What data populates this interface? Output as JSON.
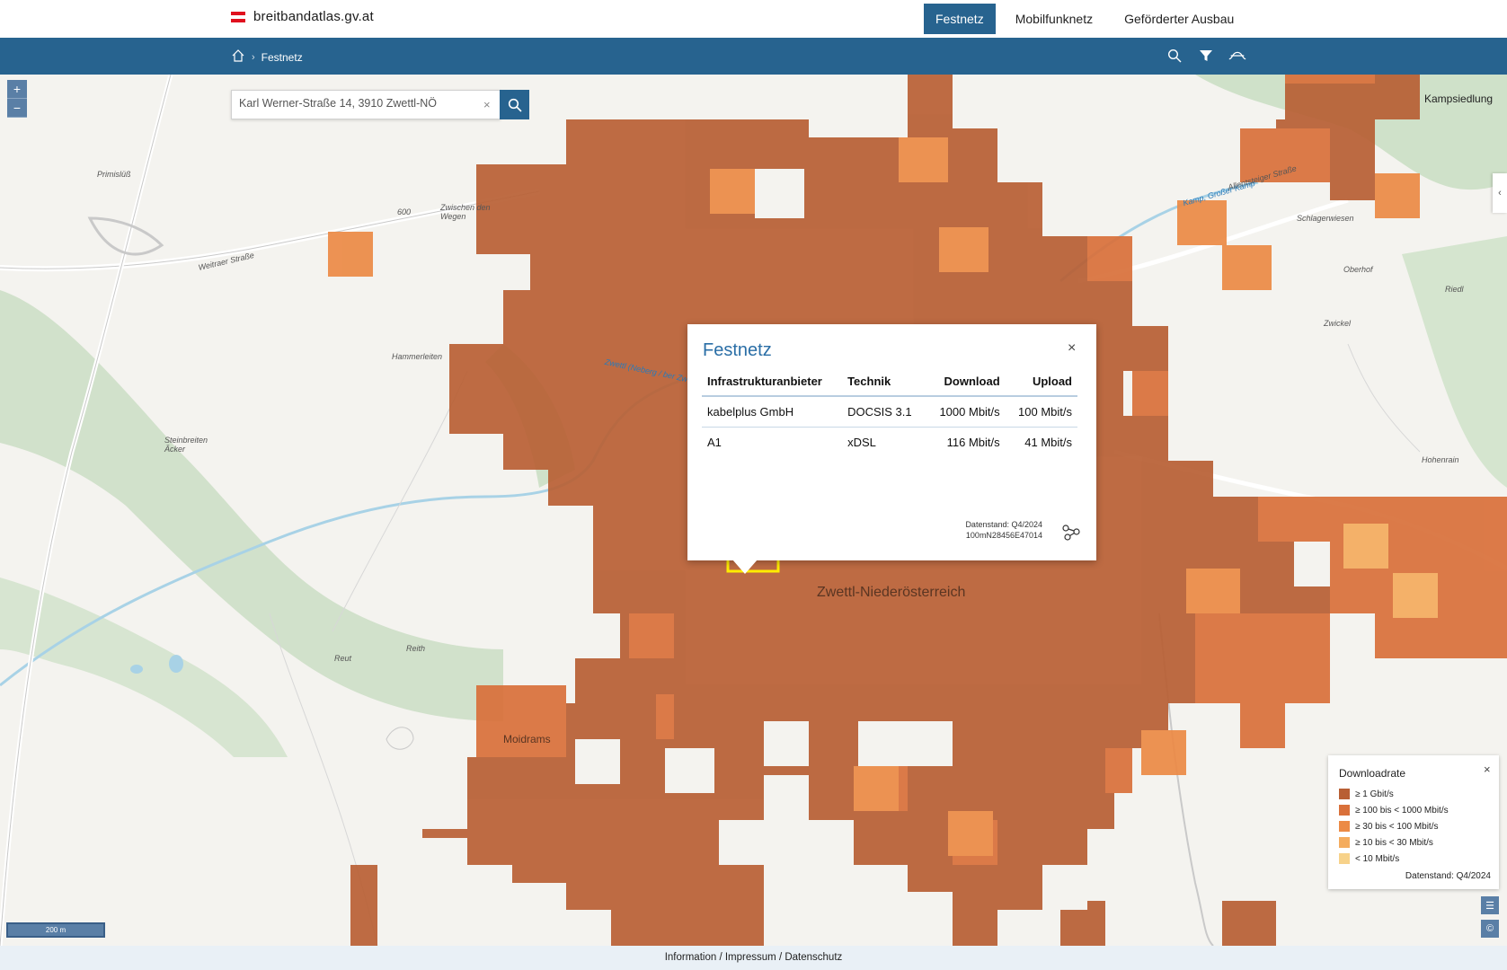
{
  "header": {
    "logo_text": "breitbandatlas.gv.at",
    "nav": [
      {
        "label": "Festnetz",
        "active": true
      },
      {
        "label": "Mobilfunknetz",
        "active": false
      },
      {
        "label": "Geförderter Ausbau",
        "active": false
      }
    ]
  },
  "breadcrumb": {
    "current": "Festnetz"
  },
  "search": {
    "value": "Karl Werner-Straße 14, 3910 Zwettl-NÖ",
    "clear": "×"
  },
  "zoom": {
    "in": "+",
    "out": "−"
  },
  "popup": {
    "title": "Festnetz",
    "close": "×",
    "columns": [
      "Infrastrukturanbieter",
      "Technik",
      "Download",
      "Upload"
    ],
    "rows": [
      [
        "kabelplus GmbH",
        "DOCSIS 3.1",
        "1000 Mbit/s",
        "100 Mbit/s"
      ],
      [
        "A1",
        "xDSL",
        "116 Mbit/s",
        "41 Mbit/s"
      ]
    ],
    "datenstand": "Datenstand: Q4/2024",
    "cell_id": "100mN28456E47014"
  },
  "legend": {
    "title": "Downloadrate",
    "close": "×",
    "items": [
      {
        "label": "≥ 1 Gbit/s",
        "color": "#b85f34"
      },
      {
        "label": "≥ 100 bis < 1000 Mbit/s",
        "color": "#d9703a"
      },
      {
        "label": "≥ 30 bis < 100 Mbit/s",
        "color": "#ec8a45"
      },
      {
        "label": "≥ 10 bis < 30 Mbit/s",
        "color": "#f4ac5e"
      },
      {
        "label": "< 10 Mbit/s",
        "color": "#f7d28a"
      }
    ],
    "datenstand": "Datenstand: Q4/2024"
  },
  "map_labels": {
    "town": "Zwettl-Niederösterreich",
    "kampsiedlung": "Kampsiedlung",
    "primislss": "Primislüß",
    "zwischen": "Zwischen den Wegen",
    "hammerleiten": "Hammerleiten",
    "steinbreiten": "Steinbreiten Äcker",
    "reut": "Reut",
    "reith": "Reith",
    "moidrams": "Moidrams",
    "oberhof": "Oberhof",
    "riedl": "Riedl",
    "zwickel": "Zwickel",
    "hohenrain": "Hohenrain",
    "schlagerwiesen": "Schlagerwiesen",
    "weitraer": "Weitraer Straße",
    "kamp": "Kamp, Großer Kamp",
    "allentsteiger": "Allentsteiger Straße",
    "zwettl_fluss": "Zwettl (Neberg / ber Zwe",
    "h600": "600"
  },
  "scale": "200 m",
  "footer": {
    "links": [
      "Information",
      "Impressum",
      "Datenschutz"
    ],
    "sep": "/"
  },
  "colors": {
    "brand": "#27638f",
    "tile_dark": "#b85f34"
  }
}
